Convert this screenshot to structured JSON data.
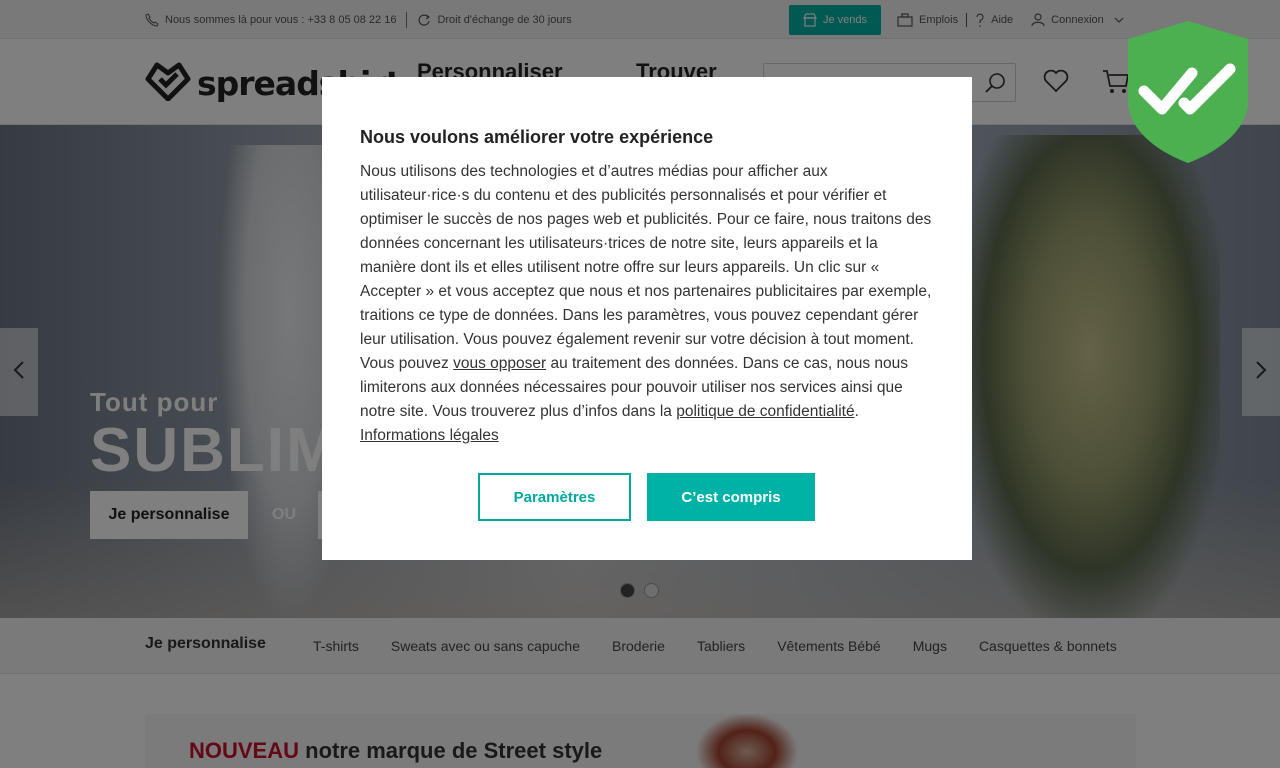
{
  "topbar": {
    "phone_text": "Nous sommes là pour vous : +33 8 05 08 22 16",
    "exchange_text": "Droit d'échange de 30 jours",
    "sell_label": "Je vends",
    "jobs_label": "Emplois",
    "help_label": "Aide",
    "login_label": "Connexion"
  },
  "header": {
    "logo_text": "spreadshirt",
    "nav": [
      "Personnaliser",
      "Trouver"
    ],
    "search_placeholder": ""
  },
  "hero": {
    "subtitle": "Tout pour",
    "title": "SUBLIM",
    "primary_button": "Je personnalise",
    "or_text": "OU"
  },
  "categories": {
    "title": "Je personnalise",
    "items": [
      "T-shirts",
      "Sweats avec ou sans capuche",
      "Broderie",
      "Tabliers",
      "Vêtements Bébé",
      "Mugs",
      "Casquettes & bonnets"
    ]
  },
  "banner": {
    "highlight": "NOUVEAU",
    "text": " notre marque de Street style"
  },
  "consent": {
    "title": "Nous voulons améliorer votre expérience",
    "body_1": "Nous utilisons des technologies et d’autres médias pour afficher aux utilisateur·rice·s du contenu et des publicités personnalisés et pour vérifier et optimiser le succès de nos pages web et publicités. Pour ce faire, nous traitons des données concernant les utilisateurs·trices de notre site, leurs appareils et la manière dont ils et elles utilisent notre offre sur leurs appareils. Un clic sur « Accepter » et vous acceptez que nous et nos partenaires publicitaires par exemple, traitions ce type de données. Dans les paramètres, vous pouvez cependant gérer leur utilisation. Vous pouvez également revenir sur votre décision à tout moment. Vous pouvez ",
    "link_oppose": "vous opposer",
    "body_2": " au traitement des données. Dans ce cas, nous nous limiterons aux données nécessaires pour pouvoir utiliser nos services ainsi que notre site. Vous trouverez plus d’infos dans la ",
    "link_privacy": "politique de confidentialité",
    "body_3": ". ",
    "link_legal": "Informations légales",
    "settings_label": "Paramètres",
    "accept_label": "C’est compris"
  },
  "colors": {
    "accent": "#00b2a5",
    "shield_green": "#4caf50",
    "banner_red": "#c8102e"
  }
}
